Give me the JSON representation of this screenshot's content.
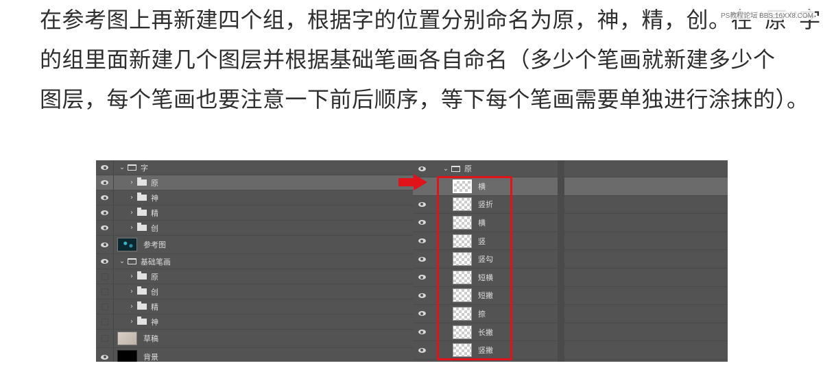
{
  "article": {
    "lines": [
      "在参考图上再新建四个组，根据字的位置分别命名为原，神，精，创。在“原”字",
      "的组里面新建几个图层并根据基础笔画各自命名（多少个笔画就新建多少个",
      "图层，每个笔画也要注意一下前后顺序，等下每个笔画需要单独进行涂抹的）。"
    ],
    "watermark": "PS教程论坛 BBS.16XX8.COM"
  },
  "left_panel": {
    "rows": [
      {
        "label": "字"
      },
      {
        "label": "原"
      },
      {
        "label": "神"
      },
      {
        "label": "精"
      },
      {
        "label": "创"
      },
      {
        "label": "参考图"
      },
      {
        "label": "基础笔画"
      },
      {
        "label": "原"
      },
      {
        "label": "创"
      },
      {
        "label": "精"
      },
      {
        "label": "神"
      },
      {
        "label": "草稿"
      },
      {
        "label": "背景"
      }
    ]
  },
  "right_panel": {
    "group_label": "原",
    "layers": [
      {
        "label": "横"
      },
      {
        "label": "竖折"
      },
      {
        "label": "横"
      },
      {
        "label": "竖"
      },
      {
        "label": "竖勾"
      },
      {
        "label": "短横"
      },
      {
        "label": "短撇"
      },
      {
        "label": "捺"
      },
      {
        "label": "长撇"
      },
      {
        "label": "竖撇"
      }
    ]
  },
  "colors": {
    "panel_bg": "#535353",
    "selected_row": "#696969",
    "highlight": "#e1131a"
  }
}
